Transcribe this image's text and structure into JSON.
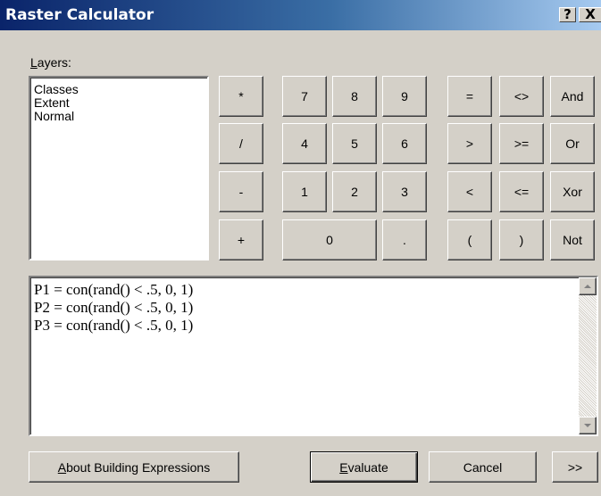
{
  "window": {
    "title": "Raster Calculator",
    "help_glyph": "?",
    "close_glyph": "X"
  },
  "layers": {
    "label_key": "L",
    "label_rest": "ayers:",
    "items": [
      "Classes",
      "Extent",
      "Normal"
    ]
  },
  "keypad": {
    "multiply": "*",
    "divide": "/",
    "minus": "-",
    "plus": "+",
    "d7": "7",
    "d8": "8",
    "d9": "9",
    "d4": "4",
    "d5": "5",
    "d6": "6",
    "d1": "1",
    "d2": "2",
    "d3": "3",
    "d0": "0",
    "dot": ".",
    "eq": "=",
    "ne": "<>",
    "and": "And",
    "gt": ">",
    "ge": ">=",
    "or": "Or",
    "lt": "<",
    "le": "<=",
    "xor": "Xor",
    "lparen": "(",
    "rparen": ")",
    "not": "Not"
  },
  "expression": {
    "lines": [
      "P1 = con(rand() < .5, 0, 1)",
      "P2 = con(rand() < .5, 0, 1)",
      "P3 = con(rand() < .5, 0, 1)"
    ]
  },
  "footer": {
    "about_key": "A",
    "about_rest": "bout Building Expressions",
    "evaluate_key": "E",
    "evaluate_rest": "valuate",
    "cancel": "Cancel",
    "more": ">>"
  }
}
